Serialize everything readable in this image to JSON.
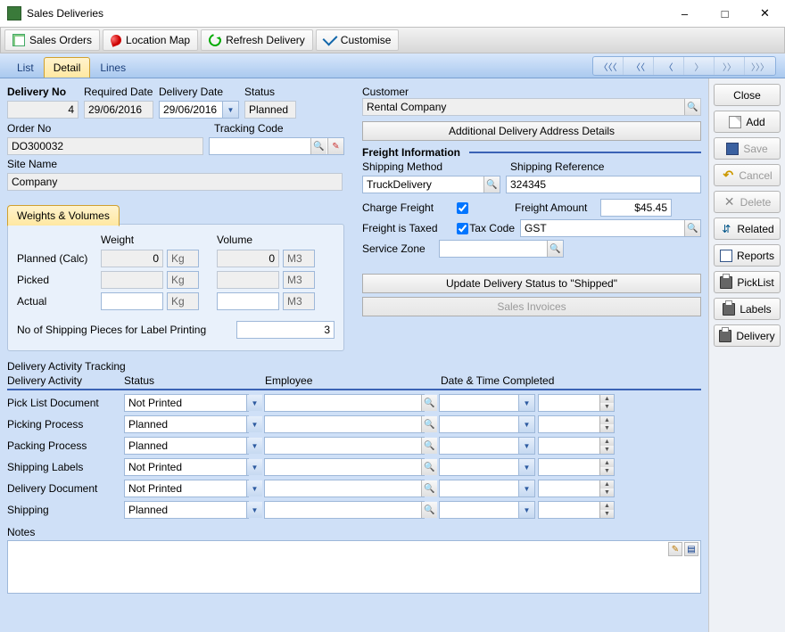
{
  "window": {
    "title": "Sales Deliveries"
  },
  "toolbar": {
    "sales_orders": "Sales Orders",
    "location_map": "Location Map",
    "refresh_delivery": "Refresh Delivery",
    "customise": "Customise"
  },
  "tabs": {
    "list": "List",
    "detail": "Detail",
    "lines": "Lines"
  },
  "header": {
    "delivery_no_label": "Delivery No",
    "delivery_no": "4",
    "required_date_label": "Required Date",
    "required_date": "29/06/2016",
    "delivery_date_label": "Delivery Date",
    "delivery_date": "29/06/2016",
    "status_label": "Status",
    "status": "Planned",
    "order_no_label": "Order No",
    "order_no": "DO300032",
    "tracking_code_label": "Tracking Code",
    "tracking_code": "",
    "site_name_label": "Site Name",
    "site_name": "Company"
  },
  "customer": {
    "label": "Customer",
    "value": "Rental Company",
    "addr_btn": "Additional Delivery Address Details"
  },
  "wv": {
    "tab": "Weights & Volumes",
    "weight_h": "Weight",
    "volume_h": "Volume",
    "planned": "Planned (Calc)",
    "picked": "Picked",
    "actual": "Actual",
    "planned_w": "0",
    "planned_v": "0",
    "picked_w": "",
    "picked_v": "",
    "actual_w": "",
    "actual_v": "",
    "kg": "Kg",
    "m3": "M3",
    "pieces_label": "No of Shipping Pieces for Label Printing",
    "pieces": "3"
  },
  "freight": {
    "header": "Freight Information",
    "ship_method_label": "Shipping Method",
    "ship_method": "TruckDelivery",
    "ship_ref_label": "Shipping Reference",
    "ship_ref": "324345",
    "charge_label": "Charge Freight",
    "charge": true,
    "amount_label": "Freight Amount",
    "amount": "$45.45",
    "taxed_label": "Freight is Taxed",
    "taxed": true,
    "tax_code_label": "Tax Code",
    "tax_code": "GST",
    "service_zone_label": "Service Zone",
    "service_zone": "",
    "update_btn": "Update Delivery Status to \"Shipped\"",
    "invoices_btn": "Sales Invoices"
  },
  "dat": {
    "title": "Delivery Activity Tracking",
    "h_activity": "Delivery Activity",
    "h_status": "Status",
    "h_employee": "Employee",
    "h_datetime": "Date & Time Completed",
    "rows": [
      {
        "label": "Pick List Document",
        "status": "Not Printed"
      },
      {
        "label": "Picking Process",
        "status": "Planned"
      },
      {
        "label": "Packing Process",
        "status": "Planned"
      },
      {
        "label": "Shipping Labels",
        "status": "Not Printed"
      },
      {
        "label": "Delivery Document",
        "status": "Not Printed"
      },
      {
        "label": "Shipping",
        "status": "Planned"
      }
    ]
  },
  "notes": {
    "label": "Notes",
    "value": ""
  },
  "side": {
    "close": "Close",
    "add": "Add",
    "save": "Save",
    "cancel": "Cancel",
    "delete": "Delete",
    "related": "Related",
    "reports": "Reports",
    "picklist": "PickList",
    "labels": "Labels",
    "delivery": "Delivery"
  }
}
